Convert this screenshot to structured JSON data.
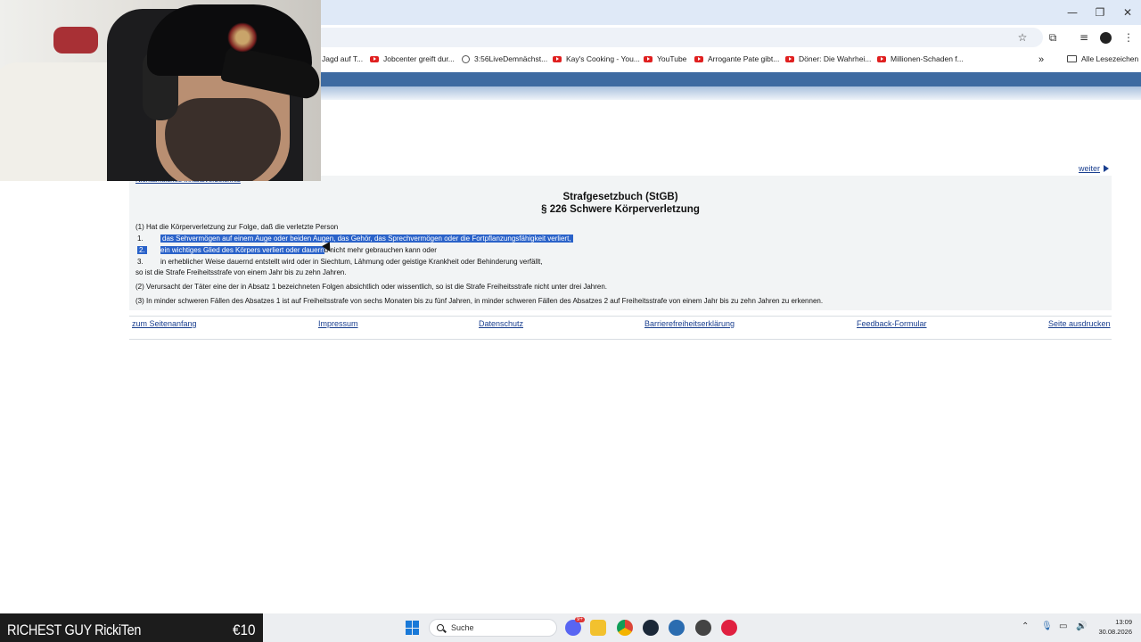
{
  "browser": {
    "window_controls": {
      "minimize": "—",
      "restore": "❐",
      "close": "✕"
    },
    "bookmarks": [
      {
        "label": "Jagd auf T...",
        "icon": "none"
      },
      {
        "label": "Jobcenter greift dur...",
        "icon": "youtube-icon"
      },
      {
        "label": "3:56LiveDemnächst...",
        "icon": "globe-icon"
      },
      {
        "label": "Kay's Cooking - You...",
        "icon": "youtube-icon"
      },
      {
        "label": "YouTube",
        "icon": "youtube-icon"
      },
      {
        "label": "Arrogante Pate gibt...",
        "icon": "youtube-icon"
      },
      {
        "label": "Döner: Die Wahrhei...",
        "icon": "youtube-icon"
      },
      {
        "label": "Millionen-Schaden f...",
        "icon": "youtube-icon"
      }
    ],
    "bookmarks_overflow": "»",
    "all_bookmarks": "Alle Lesezeichen"
  },
  "page": {
    "nav_stub": "Nichtamtliches Inhaltsverzeichnis",
    "weiter": "weiter",
    "title_line1": "Strafgesetzbuch (StGB)",
    "title_line2": "§ 226 Schwere Körperverletzung",
    "p1_intro": "(1) Hat die Körperverletzung zur Folge, daß die verletzte Person",
    "item1_num": "1.",
    "item1_text": "das Sehvermögen auf einem Auge oder beiden Augen, das Gehör, das Sprechvermögen oder die Fortpflanzungsfähigkeit verliert,",
    "item2_num": "2.",
    "item2_text_selected": "ein wichtiges Glied des Körpers verliert oder dauern",
    "item2_text_rest": "d nicht mehr gebrauchen kann oder",
    "item3_num": "3.",
    "item3_text": "in erheblicher Weise dauernd entstellt wird oder in Siechtum, Lähmung oder geistige Krankheit oder Behinderung verfällt,",
    "p1_outro": "so ist die Strafe Freiheitsstrafe von einem Jahr bis zu zehn Jahren.",
    "p2": "(2) Verursacht der Täter eine der in Absatz 1 bezeichneten Folgen absichtlich oder wissentlich, so ist die Strafe Freiheitsstrafe nicht unter drei Jahren.",
    "p3": "(3) In minder schweren Fällen des Absatzes 1 ist auf Freiheitsstrafe von sechs Monaten bis zu fünf Jahren, in minder schweren Fällen des Absatzes 2 auf Freiheitsstrafe von einem Jahr bis zu zehn Jahren zu erkennen."
  },
  "footer": {
    "top": "zum Seitenanfang",
    "impressum": "Impressum",
    "datenschutz": "Datenschutz",
    "barriere": "Barrierefreiheitserklärung",
    "feedback": "Feedback-Formular",
    "print": "Seite ausdrucken"
  },
  "overlay": {
    "name": "RICHEST GUY RickiTen",
    "amount": "€10"
  },
  "taskbar": {
    "search_placeholder": "Suche",
    "discord_badge": "9+",
    "time": "13:09",
    "date": "30.08.2026"
  },
  "colors": {
    "link": "#1a3f8f",
    "selection": "#2a62c9",
    "header_band": "#3d6aa1"
  }
}
